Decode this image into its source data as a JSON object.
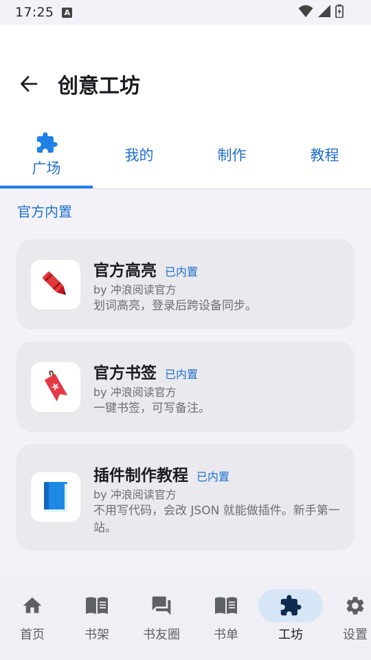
{
  "status_bar": {
    "time": "17:25",
    "a_badge": "A"
  },
  "header": {
    "title": "创意工坊"
  },
  "tabs": [
    {
      "label": "广场",
      "active": true,
      "icon": "puzzle-icon"
    },
    {
      "label": "我的",
      "active": false
    },
    {
      "label": "制作",
      "active": false
    },
    {
      "label": "教程",
      "active": false
    }
  ],
  "section": {
    "title": "官方内置"
  },
  "plugins": [
    {
      "title": "官方高亮",
      "badge": "已内置",
      "author": "by 冲浪阅读官方",
      "description": "划词高亮，登录后跨设备同步。",
      "icon": "crayon-icon"
    },
    {
      "title": "官方书签",
      "badge": "已内置",
      "author": "by 冲浪阅读官方",
      "description": "一键书签，可写备注。",
      "icon": "bookmark-icon"
    },
    {
      "title": "插件制作教程",
      "badge": "已内置",
      "author": "by 冲浪阅读官方",
      "description": "不用写代码，会改 JSON 就能做插件。新手第一站。",
      "icon": "book-icon"
    }
  ],
  "bottom_nav": [
    {
      "label": "首页",
      "icon": "home-icon",
      "active": false
    },
    {
      "label": "书架",
      "icon": "open-book-icon",
      "active": false
    },
    {
      "label": "书友圈",
      "icon": "chat-icon",
      "active": false
    },
    {
      "label": "书单",
      "icon": "open-book-icon",
      "active": false
    },
    {
      "label": "工坊",
      "icon": "puzzle-icon",
      "active": true
    },
    {
      "label": "设置",
      "icon": "gear-icon",
      "active": false
    }
  ],
  "colors": {
    "accent": "#1f6fd1",
    "active_nav_bg": "#d7e6f7",
    "card_bg": "#e9e9ee"
  }
}
